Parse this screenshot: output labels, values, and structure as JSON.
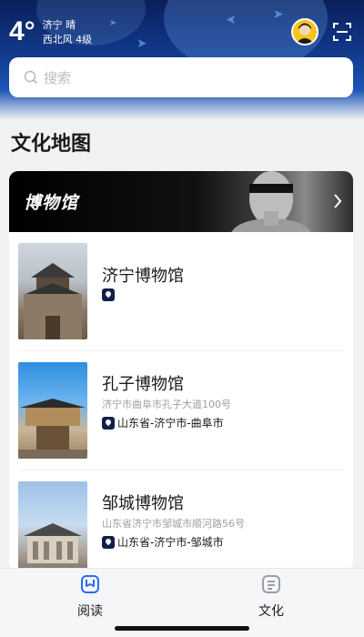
{
  "header": {
    "temperature": "4°",
    "city_weather": "济宁 晴",
    "wind": "西北风 4级"
  },
  "search": {
    "placeholder": "搜索"
  },
  "section": {
    "title": "文化地图"
  },
  "category": {
    "title": "博物馆"
  },
  "museums": [
    {
      "name": "济宁博物馆",
      "address": "",
      "region": ""
    },
    {
      "name": "孔子博物馆",
      "address": "济宁市曲阜市孔子大道100号",
      "region": "山东省-济宁市-曲阜市"
    },
    {
      "name": "邹城博物馆",
      "address": "山东省济宁市邹城市顺河路56号",
      "region": "山东省-济宁市-邹城市"
    }
  ],
  "tabs": [
    {
      "label": "阅读",
      "active": true
    },
    {
      "label": "文化",
      "active": false
    }
  ],
  "colors": {
    "active_tab": "#2a6df4",
    "inactive_tab": "#9a9ea6",
    "pin": "#12204a"
  }
}
